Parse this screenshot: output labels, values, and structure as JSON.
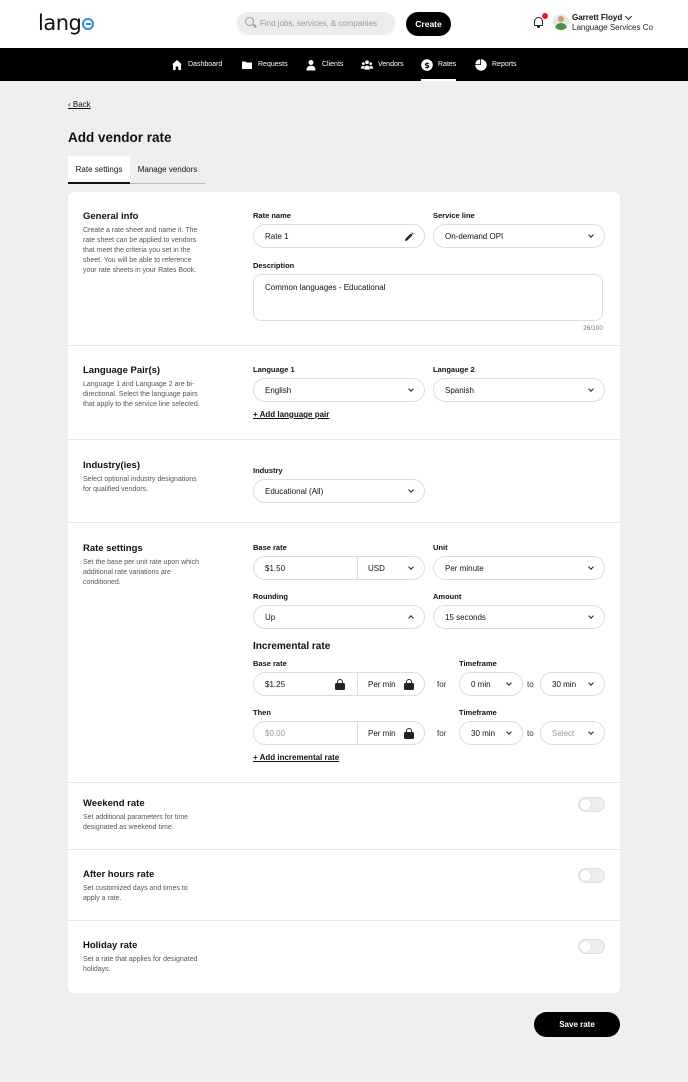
{
  "header": {
    "logo_text": "lang",
    "search": {
      "placeholder": "Find jobs, services, & companies"
    },
    "create_label": "Create",
    "user": {
      "name": "Garrett Floyd",
      "org": "Language Services Co"
    }
  },
  "nav": {
    "items": [
      {
        "label": "Dashboard",
        "icon": "home-icon"
      },
      {
        "label": "Requests",
        "icon": "folder-icon"
      },
      {
        "label": "Clients",
        "icon": "person-icon"
      },
      {
        "label": "Vendors",
        "icon": "group-icon"
      },
      {
        "label": "Rates",
        "icon": "dollar-icon",
        "active": true
      },
      {
        "label": "Reports",
        "icon": "pie-chart-icon"
      }
    ]
  },
  "page": {
    "back_label": "‹ Back",
    "title": "Add vendor rate",
    "tabs": [
      {
        "label": "Rate settings",
        "active": true
      },
      {
        "label": "Manage vendors"
      }
    ]
  },
  "general_info": {
    "title": "General info",
    "desc": "Create a rate sheet and name it. The rate sheet can be applied to vendors that meet the criteria you set in the sheet. You will be able to reference your rate sheets in your Rates Book.",
    "rate_name_label": "Rate name",
    "rate_name_value": "Rate 1",
    "service_line_label": "Service line",
    "service_line_value": "On-demand OPI",
    "description_label": "Description",
    "description_value": "Common languages - Educational",
    "counter": "26/100"
  },
  "language_pairs": {
    "title": "Language Pair(s)",
    "desc": "Language 1 and Language 2 are bi-directional. Select the language pairs that apply to the service line selected.",
    "lang1_label": "Language 1",
    "lang1_value": "English",
    "lang2_label": "Langauge 2",
    "lang2_value": "Spanish",
    "add_link": "+ Add language pair"
  },
  "industries": {
    "title": "Industry(ies)",
    "desc": "Select optional industry designations for qualified vendors.",
    "industry_label": "Industry",
    "industry_value": "Educational (All)"
  },
  "rate_settings": {
    "title": "Rate settings",
    "desc": "Set the base per unit rate upon which additional rate variations are conditioned.",
    "base_rate_label": "Base rate",
    "base_rate_value": "$1.50",
    "currency_value": "USD",
    "unit_label": "Unit",
    "unit_value": "Per minute",
    "rounding_label": "Rounding",
    "rounding_value": "Up",
    "amount_label": "Amount",
    "amount_value": "15 seconds",
    "incremental_title": "Incremental rate",
    "inc_base_label": "Base rate",
    "inc_base_value": "$1.25",
    "inc_per_value": "Per min",
    "timeframe_label": "Timeframe",
    "for_text": "for",
    "to_text": "to",
    "inc_from_value": "0 min",
    "inc_to_value": "30 min",
    "then_label": "Then",
    "then_placeholder": "$0.00",
    "then_per_value": "Per min",
    "then_timeframe_label": "Timeframe",
    "then_from_value": "30 min",
    "then_to_placeholder": "Select",
    "add_link": "+ Add incremental rate"
  },
  "weekend": {
    "title": "Weekend rate",
    "desc": "Set additional parameters for time designated as weekend time."
  },
  "after_hours": {
    "title": "After hours rate",
    "desc": "Set customized days and times to apply a rate."
  },
  "holiday": {
    "title": "Holiday rate",
    "desc": "Set a rate that applies for designated holidays."
  },
  "footer": {
    "save_label": "Save rate"
  }
}
